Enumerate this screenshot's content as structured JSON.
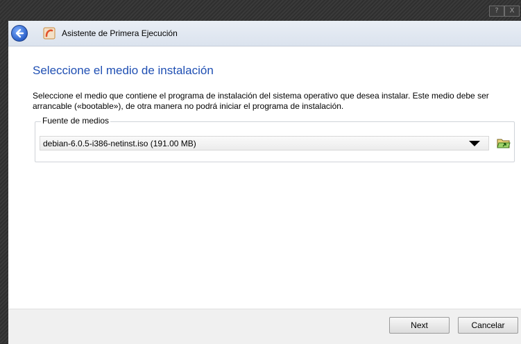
{
  "window": {
    "help_glyph": "?",
    "close_glyph": "X"
  },
  "header": {
    "title": "Asistente de Primera Ejecución"
  },
  "page": {
    "title": "Seleccione el medio de instalación",
    "description": "Seleccione el medio que contiene el programa de instalación del sistema operativo que desea instalar. Este medio debe ser arrancable («bootable»), de otra manera no podrá iniciar el programa de instalación."
  },
  "media_group": {
    "legend": "Fuente de medios",
    "selected_value": "debian-6.0.5-i386-netinst.iso (191.00 MB)"
  },
  "buttons": {
    "next": "Next",
    "cancel": "Cancelar"
  },
  "colors": {
    "title_blue": "#1f4fb3",
    "header_bg": "#dbe3ee"
  },
  "icons": {
    "back": "back-arrow-icon",
    "app": "virtualbox-app-icon",
    "folder": "folder-open-icon",
    "dropdown": "chevron-down-icon"
  }
}
